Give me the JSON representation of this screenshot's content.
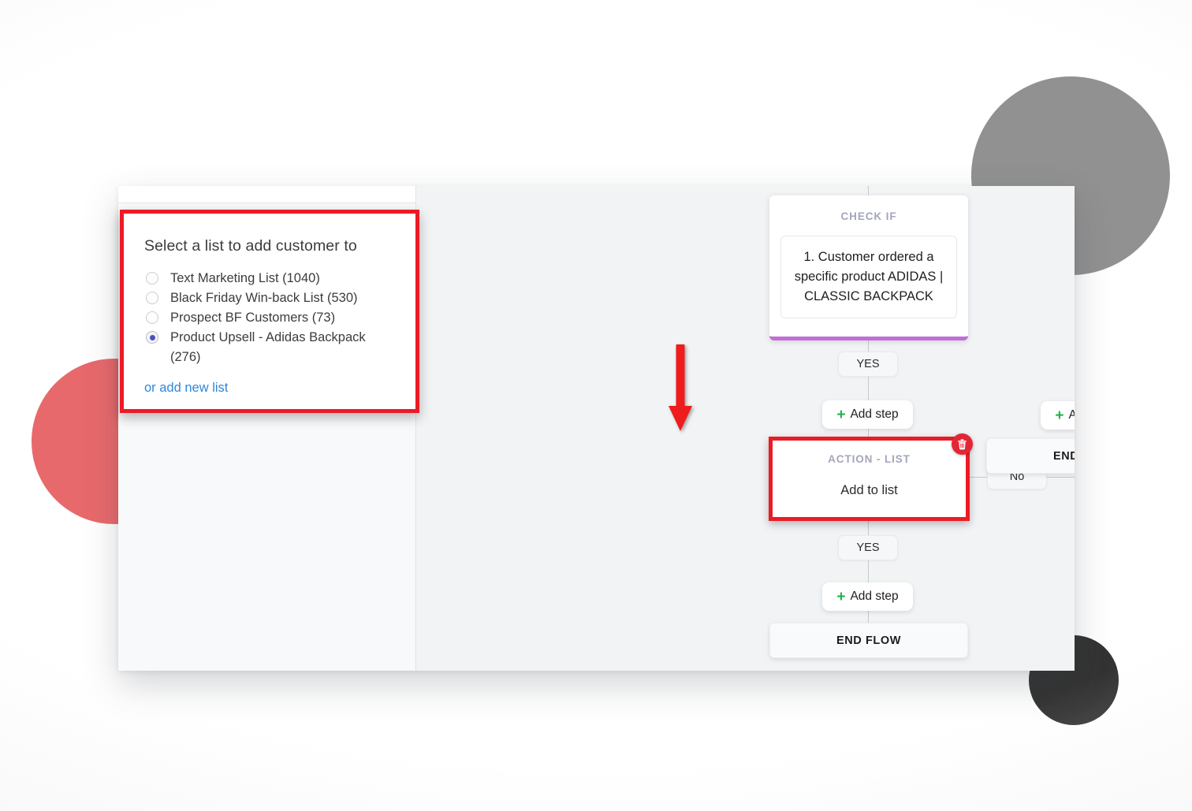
{
  "decor": {
    "coral_color": "#e8696c",
    "grey_color": "#919191",
    "dark_color": "#333333"
  },
  "list_panel": {
    "title": "Select a list to add customer to",
    "options": [
      {
        "label": "Text Marketing List (1040)",
        "selected": false
      },
      {
        "label": "Black Friday Win-back List (530)",
        "selected": false
      },
      {
        "label": "Prospect BF Customers (73)",
        "selected": false
      },
      {
        "label": "Product Upsell - Adidas Backpack (276)",
        "selected": true
      }
    ],
    "add_new_link": "or add new list",
    "highlight_color": "#ec1b24",
    "selected_radio_color": "#4b4fbe",
    "link_color": "#2f86dd"
  },
  "flow": {
    "check_if": {
      "kicker": "CHECK IF",
      "condition": "1. Customer ordered a specific product ADIDAS | CLASSIC BACKPACK",
      "accent_color": "#bf6fd6"
    },
    "branch_yes_label": "YES",
    "branch_no_label": "No",
    "branch_yes_label_2": "YES",
    "add_step_label": "Add step",
    "add_step_plus": "+",
    "action_list": {
      "kicker": "ACTION - LIST",
      "body": "Add to list",
      "delete_icon": "trash-icon",
      "delete_color": "#e32636",
      "highlight_color": "#ec1b24"
    },
    "end_flow_label": "END FLOW",
    "end_flow_label_right": "END FLOW",
    "annotation_arrow_color": "#ee1c1c"
  }
}
